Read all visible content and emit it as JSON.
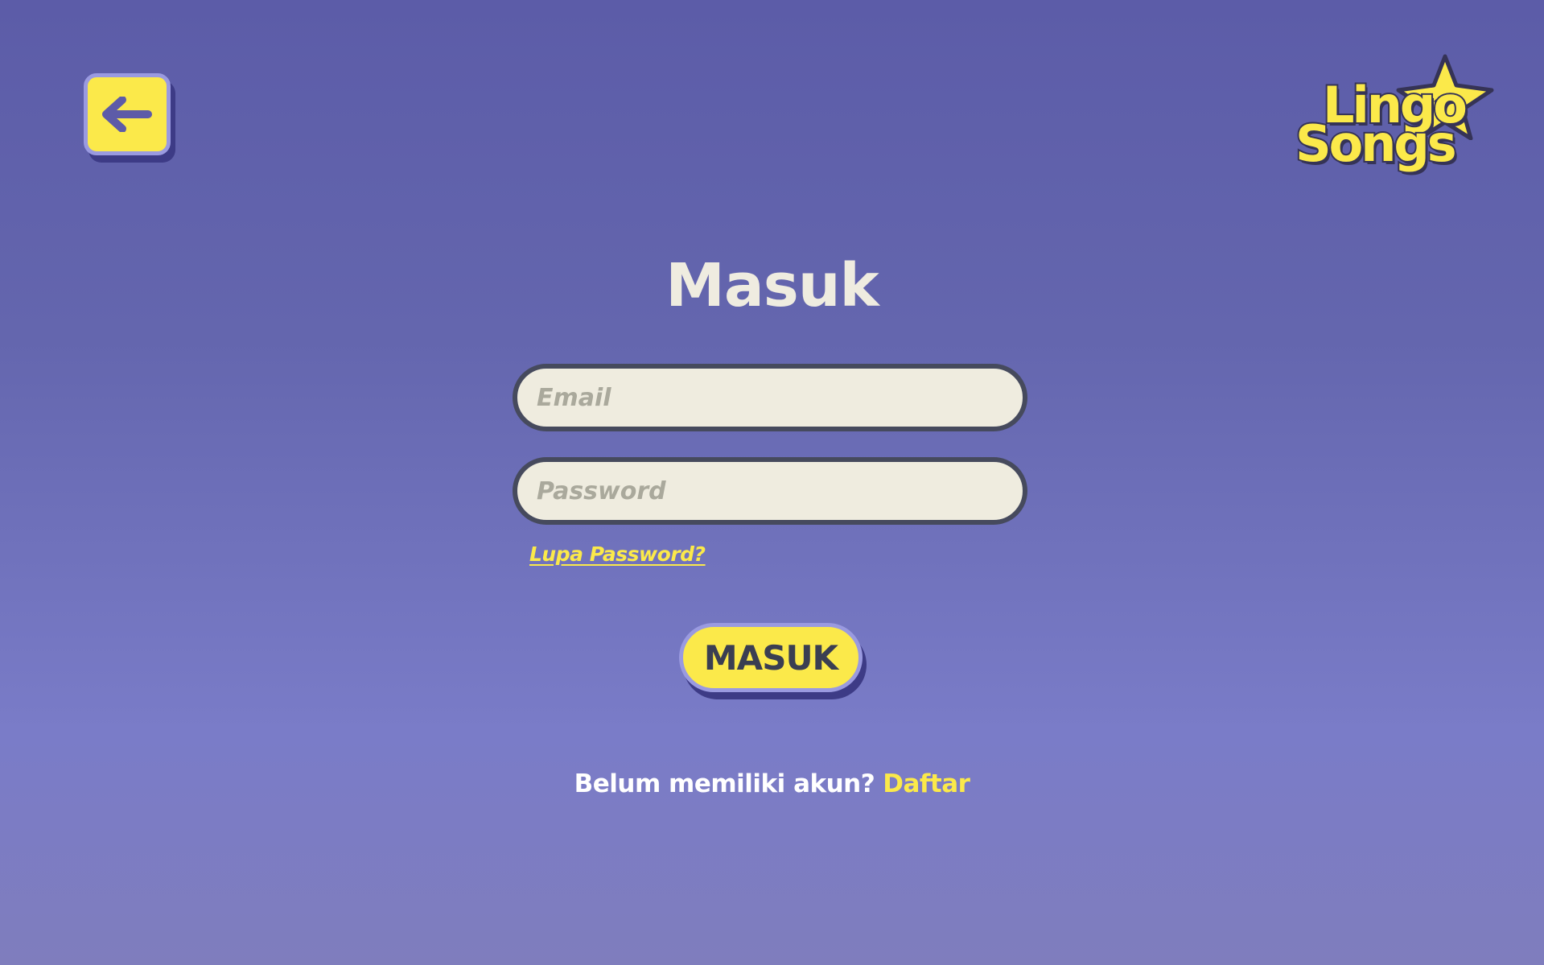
{
  "header": {
    "back_icon": "arrow-left-icon",
    "logo": {
      "line1": "Lingo",
      "line2": "Songs"
    }
  },
  "login": {
    "title": "Masuk",
    "email_placeholder": "Email",
    "email_value": "",
    "password_placeholder": "Password",
    "password_value": "",
    "forgot_label": "Lupa Password?",
    "submit_label": "MASUK",
    "signup_prompt": "Belum memiliki akun?",
    "signup_link": "Daftar"
  },
  "colors": {
    "background_top": "#5c5ca8",
    "background_bottom": "#7f7dbd",
    "accent_yellow": "#fbe94a",
    "input_background": "#efecdf",
    "input_border": "#464a5d",
    "title_text": "#efece0",
    "button_text": "#3a3e52"
  }
}
